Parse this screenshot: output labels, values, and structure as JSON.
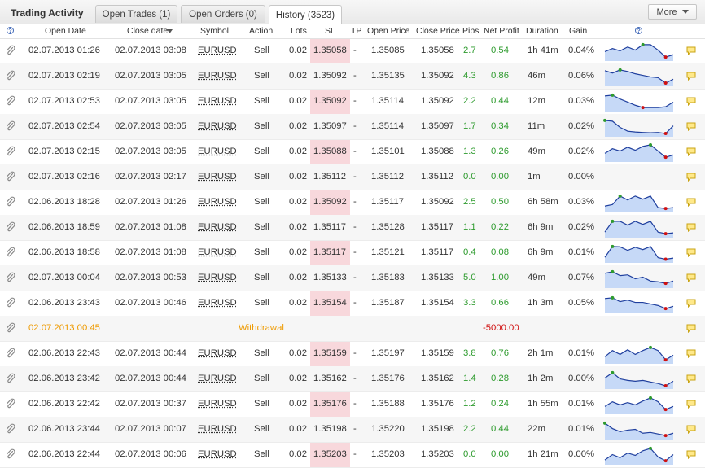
{
  "header": {
    "title": "Trading Activity",
    "tabs": [
      {
        "label": "Open Trades (1)",
        "active": false
      },
      {
        "label": "Open Orders (0)",
        "active": false
      },
      {
        "label": "History (3523)",
        "active": true
      }
    ],
    "more_label": "More"
  },
  "columns": {
    "open_date": "Open Date",
    "close_date": "Close date",
    "symbol": "Symbol",
    "action": "Action",
    "lots": "Lots",
    "sl": "SL",
    "tp": "TP",
    "open_price": "Open Price",
    "close_price": "Close Price",
    "pips": "Pips",
    "net_profit": "Net Profit",
    "duration": "Duration",
    "gain": "Gain"
  },
  "colors": {
    "profit": "#2e9b2e",
    "loss": "#d01010",
    "withdrawal": "#ee9a00",
    "sl_highlight": "#f8d8dc",
    "sparkline_fill": "#c6d9f7",
    "sparkline_line": "#1f3f9e"
  },
  "icons": {
    "row_icon": "paperclip-icon",
    "comment_icon": "speech-bubble-icon",
    "help_icon": "question-circle-icon",
    "sort_icon": "sort-desc-icon"
  },
  "rows": [
    {
      "type": "trade",
      "open_date": "02.07.2013 01:26",
      "close_date": "02.07.2013 03:08",
      "symbol": "EURUSD",
      "action": "Sell",
      "lots": "0.02",
      "sl": "1.35058",
      "tp": "-",
      "open_price": "1.35085",
      "close_price": "1.35058",
      "pips": "2.7",
      "net_profit": "0.54",
      "duration": "1h 41m",
      "gain": "0.04%",
      "spark": [
        0.55,
        0.35,
        0.5,
        0.25,
        0.45,
        0.1,
        0.1,
        0.45,
        0.9,
        0.75
      ]
    },
    {
      "type": "trade",
      "open_date": "02.07.2013 02:19",
      "close_date": "02.07.2013 03:05",
      "symbol": "EURUSD",
      "action": "Sell",
      "lots": "0.02",
      "sl": "1.35092",
      "tp": "-",
      "open_price": "1.35135",
      "close_price": "1.35092",
      "pips": "4.3",
      "net_profit": "0.86",
      "duration": "46m",
      "gain": "0.06%",
      "spark": [
        0.15,
        0.3,
        0.1,
        0.2,
        0.35,
        0.45,
        0.55,
        0.6,
        0.95,
        0.7
      ]
    },
    {
      "type": "trade",
      "open_date": "02.07.2013 02:53",
      "close_date": "02.07.2013 03:05",
      "symbol": "EURUSD",
      "action": "Sell",
      "lots": "0.02",
      "sl": "1.35092",
      "tp": "-",
      "open_price": "1.35114",
      "close_price": "1.35092",
      "pips": "2.2",
      "net_profit": "0.44",
      "duration": "12m",
      "gain": "0.03%",
      "spark": [
        0.15,
        0.1,
        0.35,
        0.55,
        0.75,
        0.9,
        0.9,
        0.9,
        0.85,
        0.55
      ]
    },
    {
      "type": "trade",
      "open_date": "02.07.2013 02:54",
      "close_date": "02.07.2013 03:05",
      "symbol": "EURUSD",
      "action": "Sell",
      "lots": "0.02",
      "sl": "1.35097",
      "tp": "-",
      "open_price": "1.35114",
      "close_price": "1.35097",
      "pips": "1.7",
      "net_profit": "0.34",
      "duration": "11m",
      "gain": "0.02%",
      "spark": [
        0.1,
        0.15,
        0.55,
        0.8,
        0.85,
        0.88,
        0.9,
        0.88,
        0.95,
        0.45
      ]
    },
    {
      "type": "trade",
      "open_date": "02.07.2013 02:15",
      "close_date": "02.07.2013 03:05",
      "symbol": "EURUSD",
      "action": "Sell",
      "lots": "0.02",
      "sl": "1.35088",
      "tp": "-",
      "open_price": "1.35101",
      "close_price": "1.35088",
      "pips": "1.3",
      "net_profit": "0.26",
      "duration": "49m",
      "gain": "0.02%",
      "spark": [
        0.6,
        0.3,
        0.45,
        0.2,
        0.4,
        0.15,
        0.05,
        0.45,
        0.85,
        0.7
      ]
    },
    {
      "type": "trade",
      "open_date": "02.07.2013 02:16",
      "close_date": "02.07.2013 02:17",
      "symbol": "EURUSD",
      "action": "Sell",
      "lots": "0.02",
      "sl": "1.35112",
      "tp": "-",
      "open_price": "1.35112",
      "close_price": "1.35112",
      "pips": "0.0",
      "net_profit": "0.00",
      "duration": "1m",
      "gain": "0.00%",
      "spark": []
    },
    {
      "type": "trade",
      "open_date": "02.06.2013 18:28",
      "close_date": "02.07.2013 01:26",
      "symbol": "EURUSD",
      "action": "Sell",
      "lots": "0.02",
      "sl": "1.35092",
      "tp": "-",
      "open_price": "1.35117",
      "close_price": "1.35092",
      "pips": "2.5",
      "net_profit": "0.50",
      "duration": "6h 58m",
      "gain": "0.03%",
      "spark": [
        0.75,
        0.65,
        0.1,
        0.35,
        0.1,
        0.3,
        0.1,
        0.85,
        0.9,
        0.85
      ]
    },
    {
      "type": "trade",
      "open_date": "02.06.2013 18:59",
      "close_date": "02.07.2013 01:08",
      "symbol": "EURUSD",
      "action": "Sell",
      "lots": "0.02",
      "sl": "1.35117",
      "tp": "-",
      "open_price": "1.35128",
      "close_price": "1.35117",
      "pips": "1.1",
      "net_profit": "0.22",
      "duration": "6h 9m",
      "gain": "0.02%",
      "spark": [
        0.8,
        0.1,
        0.1,
        0.35,
        0.1,
        0.3,
        0.1,
        0.8,
        0.9,
        0.85
      ]
    },
    {
      "type": "trade",
      "open_date": "02.06.2013 18:58",
      "close_date": "02.07.2013 01:08",
      "symbol": "EURUSD",
      "action": "Sell",
      "lots": "0.02",
      "sl": "1.35117",
      "tp": "-",
      "open_price": "1.35121",
      "close_price": "1.35117",
      "pips": "0.4",
      "net_profit": "0.08",
      "duration": "6h 9m",
      "gain": "0.01%",
      "spark": [
        0.8,
        0.1,
        0.12,
        0.35,
        0.15,
        0.3,
        0.1,
        0.82,
        0.92,
        0.85
      ]
    },
    {
      "type": "trade",
      "open_date": "02.07.2013 00:04",
      "close_date": "02.07.2013 00:53",
      "symbol": "EURUSD",
      "action": "Sell",
      "lots": "0.02",
      "sl": "1.35133",
      "tp": "-",
      "open_price": "1.35183",
      "close_price": "1.35133",
      "pips": "5.0",
      "net_profit": "1.00",
      "duration": "49m",
      "gain": "0.07%",
      "spark": [
        0.2,
        0.1,
        0.35,
        0.3,
        0.55,
        0.45,
        0.7,
        0.75,
        0.85,
        0.7
      ]
    },
    {
      "type": "trade",
      "open_date": "02.06.2013 23:43",
      "close_date": "02.07.2013 00:46",
      "symbol": "EURUSD",
      "action": "Sell",
      "lots": "0.02",
      "sl": "1.35154",
      "tp": "-",
      "open_price": "1.35187",
      "close_price": "1.35154",
      "pips": "3.3",
      "net_profit": "0.66",
      "duration": "1h 3m",
      "gain": "0.05%",
      "spark": [
        0.2,
        0.15,
        0.4,
        0.3,
        0.45,
        0.45,
        0.55,
        0.65,
        0.85,
        0.7
      ]
    },
    {
      "type": "withdrawal",
      "open_date": "02.07.2013 00:45",
      "label": "Withdrawal",
      "amount": "-5000.00"
    },
    {
      "type": "trade",
      "open_date": "02.06.2013 22:43",
      "close_date": "02.07.2013 00:44",
      "symbol": "EURUSD",
      "action": "Sell",
      "lots": "0.02",
      "sl": "1.35159",
      "tp": "-",
      "open_price": "1.35197",
      "close_price": "1.35159",
      "pips": "3.8",
      "net_profit": "0.76",
      "duration": "2h 1m",
      "gain": "0.01%",
      "spark": [
        0.7,
        0.3,
        0.55,
        0.25,
        0.55,
        0.3,
        0.1,
        0.3,
        0.9,
        0.6
      ]
    },
    {
      "type": "trade",
      "open_date": "02.06.2013 23:42",
      "close_date": "02.07.2013 00:44",
      "symbol": "EURUSD",
      "action": "Sell",
      "lots": "0.02",
      "sl": "1.35162",
      "tp": "-",
      "open_price": "1.35176",
      "close_price": "1.35162",
      "pips": "1.4",
      "net_profit": "0.28",
      "duration": "1h 2m",
      "gain": "0.00%",
      "spark": [
        0.45,
        0.1,
        0.5,
        0.6,
        0.65,
        0.6,
        0.7,
        0.8,
        0.95,
        0.65
      ]
    },
    {
      "type": "trade",
      "open_date": "02.06.2013 22:42",
      "close_date": "02.07.2013 00:37",
      "symbol": "EURUSD",
      "action": "Sell",
      "lots": "0.02",
      "sl": "1.35176",
      "tp": "-",
      "open_price": "1.35188",
      "close_price": "1.35176",
      "pips": "1.2",
      "net_profit": "0.24",
      "duration": "1h 55m",
      "gain": "0.01%",
      "spark": [
        0.65,
        0.35,
        0.55,
        0.4,
        0.55,
        0.3,
        0.1,
        0.35,
        0.85,
        0.65
      ]
    },
    {
      "type": "trade",
      "open_date": "02.06.2013 23:44",
      "close_date": "02.07.2013 00:07",
      "symbol": "EURUSD",
      "action": "Sell",
      "lots": "0.02",
      "sl": "1.35198",
      "tp": "-",
      "open_price": "1.35220",
      "close_price": "1.35198",
      "pips": "2.2",
      "net_profit": "0.44",
      "duration": "22m",
      "gain": "0.01%",
      "spark": [
        0.1,
        0.45,
        0.65,
        0.55,
        0.5,
        0.75,
        0.7,
        0.8,
        0.9,
        0.75
      ]
    },
    {
      "type": "trade",
      "open_date": "02.06.2013 22:44",
      "close_date": "02.07.2013 00:06",
      "symbol": "EURUSD",
      "action": "Sell",
      "lots": "0.02",
      "sl": "1.35203",
      "tp": "-",
      "open_price": "1.35203",
      "close_price": "1.35203",
      "pips": "0.0",
      "net_profit": "0.00",
      "duration": "1h 21m",
      "gain": "0.00%",
      "spark": [
        0.85,
        0.5,
        0.7,
        0.4,
        0.55,
        0.25,
        0.1,
        0.65,
        0.9,
        0.5
      ]
    }
  ]
}
